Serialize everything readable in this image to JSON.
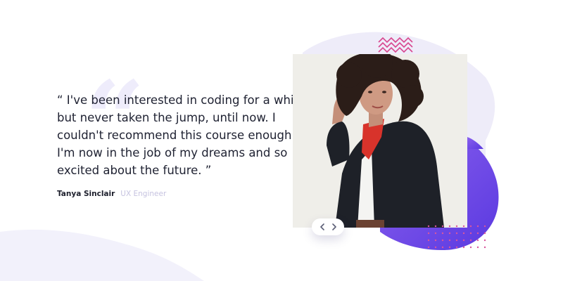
{
  "testimonial": {
    "quote": "“ I've been interested in coding for a while but never taken the jump, until now. I couldn't recommend this course enough. I'm now in the job of my dreams and so excited about the future. ”",
    "author_name": "Tanya Sinclair",
    "author_title": "UX Engineer"
  },
  "navigation": {
    "prev_icon": "chevron-left-icon",
    "next_icon": "chevron-right-icon"
  },
  "decorations": {
    "quote_glyph": "“",
    "accent_purple": "#6b4ee6",
    "accent_pink": "#d93f8c",
    "background_blob": "#eceaf8"
  }
}
